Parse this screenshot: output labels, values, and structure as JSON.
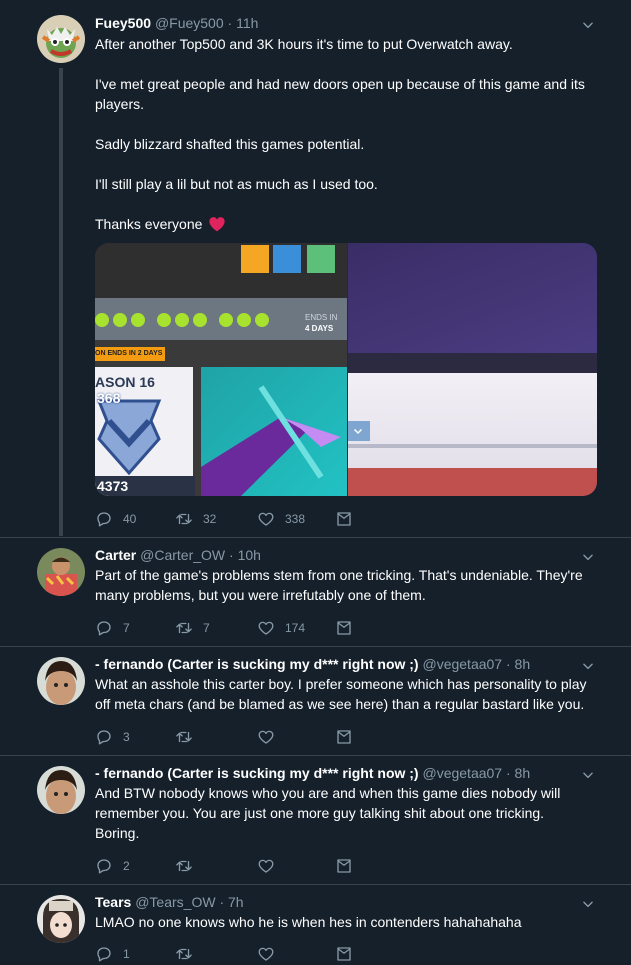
{
  "tweets": [
    {
      "name": "Fuey500",
      "handle": "@Fuey500",
      "time": "· 11h",
      "lines": [
        "After another Top500 and 3K hours it's time to put Overwatch away.",
        "I've met great people and had new doors open up because of this game and its players.",
        "Sadly blizzard shafted this games potential.",
        "I'll still play a lil but not as much as I used too.",
        "Thanks everyone"
      ],
      "replies": "40",
      "retweets": "32",
      "likes": "338"
    },
    {
      "name": "Carter",
      "handle": "@Carter_OW",
      "time": "· 10h",
      "text": "Part of the game's problems stem from one tricking. That's undeniable. They're many problems, but you were irrefutably one of them.",
      "replies": "7",
      "retweets": "7",
      "likes": "174"
    },
    {
      "name": "- fernando (Carter is sucking my d*** right now ;)",
      "handle": "@vegetaa07",
      "time": "· 8h",
      "text": "What an asshole this carter boy. I prefer someone which has personality to play off meta chars (and be blamed as we see here) than a regular bastard like you.",
      "replies": "3",
      "retweets": "",
      "likes": ""
    },
    {
      "name": "- fernando (Carter is sucking my d*** right now ;)",
      "handle": "@vegetaa07",
      "time": "· 8h",
      "text": "And BTW nobody knows who you are and when this game dies nobody will remember you.  You are just one more guy talking shit about one tricking. Boring.",
      "replies": "2",
      "retweets": "",
      "likes": ""
    },
    {
      "name": "Tears",
      "handle": "@Tears_OW",
      "time": "· 7h",
      "text": "LMAO no one knows who he is when hes in contenders hahahahaha",
      "replies": "1",
      "retweets": "",
      "likes": ""
    }
  ],
  "media": {
    "ends_in_label": "ENDS IN",
    "ends_in_value": "4 DAYS",
    "banner": "ON ENDS IN 2 DAYS",
    "season": "ASON 16",
    "sr": "368",
    "score": "4373"
  },
  "colors": {
    "background": "#15202b",
    "muted": "#8899a6",
    "divider": "#38444d",
    "heart": "#e0245e"
  }
}
